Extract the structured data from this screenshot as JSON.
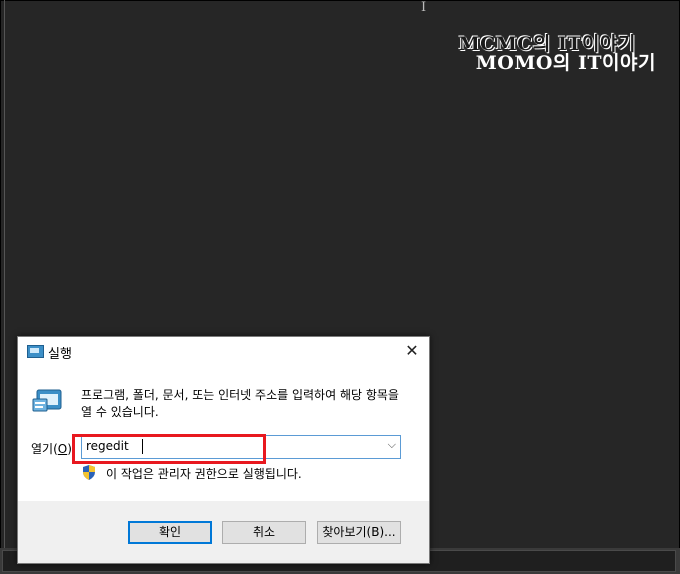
{
  "watermark": {
    "ghost_text": "MCMC의 IT이야기",
    "main_text": "MOMO의 IT이야기"
  },
  "dialog": {
    "title": "실행",
    "close_glyph": "✕",
    "description": "프로그램, 폴더, 문서, 또는 인터넷 주소를 입력하여 해당 항목을 열 수 있습니다.",
    "open_label": "열기(",
    "open_label_accel": "O",
    "open_label_end": "):",
    "input_value": "regedit",
    "dropdown_glyph": "⌵",
    "admin_note": "이 작업은 관리자 권한으로 실행됩니다.",
    "buttons": {
      "ok": "확인",
      "cancel": "취소",
      "browse": "찾아보기(B)..."
    }
  },
  "colors": {
    "desktop_background": "#262626",
    "highlight_border": "#e8181f",
    "focus_blue": "#0078d7"
  }
}
